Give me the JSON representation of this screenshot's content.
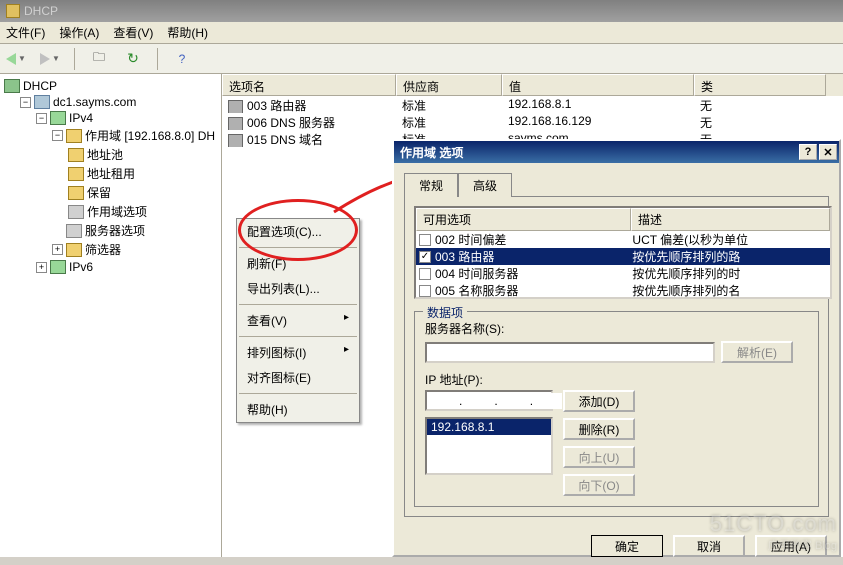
{
  "window": {
    "title": "DHCP"
  },
  "menu": {
    "file": "文件(F)",
    "action": "操作(A)",
    "view": "查看(V)",
    "help": "帮助(H)"
  },
  "tree": {
    "root": "DHCP",
    "server": "dc1.sayms.com",
    "ipv4": "IPv4",
    "scope": "作用域 [192.168.8.0] DH",
    "pool": "地址池",
    "leases": "地址租用",
    "reservations": "保留",
    "scope_options": "作用域选项",
    "server_options": "服务器选项",
    "filters": "筛选器",
    "ipv6": "IPv6"
  },
  "grid": {
    "headers": {
      "name": "选项名",
      "vendor": "供应商",
      "value": "值",
      "class": "类"
    },
    "rows": [
      {
        "name": "003 路由器",
        "vendor": "标准",
        "value": "192.168.8.1",
        "class": "无"
      },
      {
        "name": "006 DNS 服务器",
        "vendor": "标准",
        "value": "192.168.16.129",
        "class": "无"
      },
      {
        "name": "015 DNS 域名",
        "vendor": "标准",
        "value": "sayms.com",
        "class": "无"
      }
    ]
  },
  "ctx": {
    "configure": "配置选项(C)...",
    "refresh": "刷新(F)",
    "export": "导出列表(L)...",
    "view": "查看(V)",
    "arrange": "排列图标(I)",
    "align": "对齐图标(E)",
    "help": "帮助(H)"
  },
  "dialog": {
    "title": "作用域 选项",
    "tab_general": "常规",
    "tab_advanced": "高级",
    "avail_label": "可用选项",
    "desc_label": "描述",
    "options": [
      {
        "chk": false,
        "name": "002 时间偏差",
        "desc": "UCT 偏差(以秒为单位"
      },
      {
        "chk": true,
        "name": "003 路由器",
        "desc": "按优先顺序排列的路",
        "selected": true
      },
      {
        "chk": false,
        "name": "004 时间服务器",
        "desc": "按优先顺序排列的时"
      },
      {
        "chk": false,
        "name": "005 名称服务器",
        "desc": "按优先顺序排列的名"
      }
    ],
    "group_label": "数据项",
    "srvname_label": "服务器名称(S):",
    "resolve": "解析(E)",
    "ip_label": "IP 地址(P):",
    "add": "添加(D)",
    "remove": "删除(R)",
    "up": "向上(U)",
    "down": "向下(O)",
    "ip_value": "192.168.8.1",
    "ok": "确定",
    "cancel": "取消",
    "apply": "应用(A)"
  },
  "watermark": {
    "line1": "51CTO.com",
    "line2": "应用微客      Blog"
  }
}
